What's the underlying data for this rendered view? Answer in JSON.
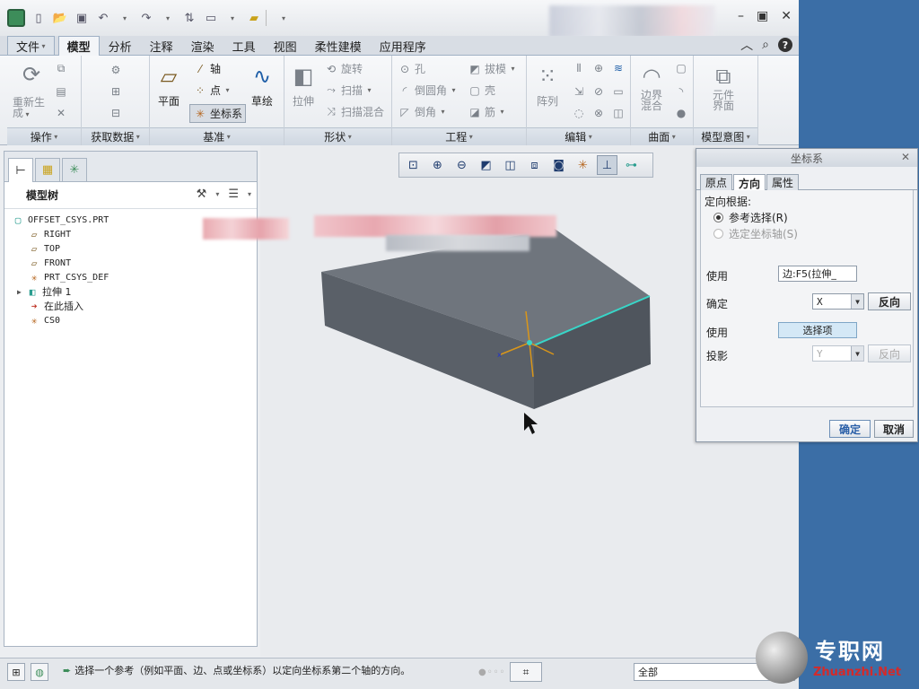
{
  "titlebar": {
    "quick_access": [
      "new-icon",
      "open-icon",
      "save-icon",
      "undo-icon",
      "redo-icon",
      "regenerate-icon",
      "window-icon",
      "close-window-icon"
    ]
  },
  "ribbon_tabs": [
    "文件",
    "模型",
    "分析",
    "注释",
    "渲染",
    "工具",
    "视图",
    "柔性建模",
    "应用程序"
  ],
  "active_tab": "模型",
  "groups": {
    "operations": {
      "label": "操作",
      "regenerate": "重新生",
      "regenerate2": "成"
    },
    "get_data": {
      "label": "获取数据"
    },
    "datum": {
      "label": "基准",
      "plane": "平面",
      "axis": "轴",
      "point": "点",
      "csys": "坐标系",
      "sketch": "草绘"
    },
    "shapes": {
      "label": "形状",
      "extrude": "拉伸",
      "revolve": "旋转",
      "sweep": "扫描",
      "swept_blend": "扫描混合"
    },
    "engineering": {
      "label": "工程",
      "hole": "孔",
      "round": "倒圆角",
      "chamfer": "倒角",
      "draft": "拔模",
      "shell": "壳",
      "rib": "筋"
    },
    "editing": {
      "label": "编辑",
      "pattern": "阵列"
    },
    "surfaces": {
      "label": "曲面",
      "boundary": "边界",
      "boundary2": "混合"
    },
    "model_intent": {
      "label": "模型意图",
      "component": "元件",
      "component2": "界面"
    }
  },
  "model_tree": {
    "title": "模型树",
    "items": [
      {
        "label": "OFFSET_CSYS.PRT",
        "icon": "part-icon"
      },
      {
        "label": "RIGHT",
        "icon": "datum-plane-icon"
      },
      {
        "label": "TOP",
        "icon": "datum-plane-icon"
      },
      {
        "label": "FRONT",
        "icon": "datum-plane-icon"
      },
      {
        "label": "PRT_CSYS_DEF",
        "icon": "csys-icon"
      },
      {
        "label": "拉伸 1",
        "icon": "extrude-icon"
      },
      {
        "label": "在此插入",
        "icon": "insert-arrow-icon"
      },
      {
        "label": "CS0",
        "icon": "csys-icon"
      }
    ]
  },
  "view_toolbar": [
    "refit-icon",
    "zoom-in-icon",
    "zoom-out-icon",
    "repaint-icon",
    "display-style-icon",
    "saved-views-icon",
    "view-manager-icon",
    "perspective-icon",
    "datum-display-icon",
    "spin-center-icon",
    "annotation-display-icon"
  ],
  "csys_dialog": {
    "title": "坐标系",
    "tabs": [
      "原点",
      "方向",
      "属性"
    ],
    "active_tab": "方向",
    "orient_by": "定向根据:",
    "radio_ref": "参考选择(R)",
    "radio_axis": "选定坐标轴(S)",
    "use1_label": "使用",
    "use1_value": "边:F5(拉伸_",
    "determine_label": "确定",
    "determine_value": "X",
    "flip1": "反向",
    "use2_label": "使用",
    "use2_value": "选择项",
    "project_label": "投影",
    "project_value": "Y",
    "flip2": "反向",
    "ok": "确定",
    "cancel": "取消"
  },
  "status": {
    "message": "选择一个参考（例如平面、边、点或坐标系）以定向坐标系第二个轴的方向。",
    "filter": "全部"
  },
  "watermark": {
    "cn": "专职网",
    "en": "Zhuanzhi.Net"
  }
}
